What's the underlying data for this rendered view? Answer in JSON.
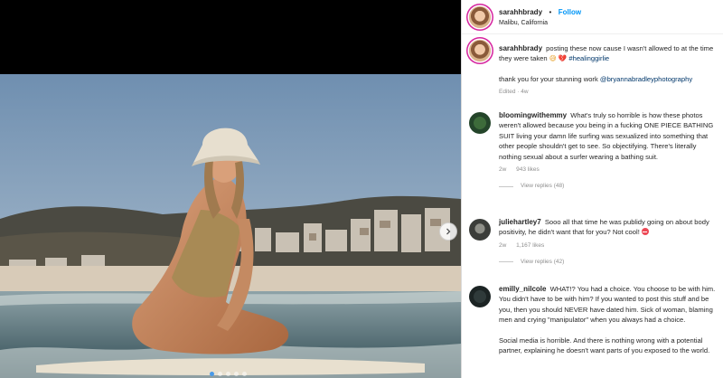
{
  "post": {
    "username": "sarahhbrady",
    "separator": "•",
    "follow_label": "Follow",
    "location": "Malibu, California"
  },
  "colors": {
    "accent": "#0095f6",
    "story_ring": "#d6249f",
    "carousel_active": "#4a9ae8"
  },
  "icons": {
    "next": "chevron-right-icon"
  },
  "carousel": {
    "slide_count": 5,
    "active_index": 0
  },
  "caption": {
    "username": "sarahhbrady",
    "text": "posting these now cause I wasn't allowed to at the time they were taken",
    "emoji_1": "😅",
    "emoji_2": "💔",
    "hashtag": "#healinggirlie",
    "thanks": "thank you for your stunning work",
    "mention": "@bryannabradleyphotography",
    "edited": "Edited · 4w"
  },
  "comments": [
    {
      "username": "bloomingwithemmy",
      "text": "What's truly so horrible is how these photos weren't allowed because you being in a fucking ONE PIECE BATHING SUIT living your damn life surfing was sexualized into something that other people shouldn't get to see. So objectifying. There's literally nothing sexual about a surfer wearing a bathing suit.",
      "time": "2w",
      "likes": "943 likes",
      "replies": "View replies (48)"
    },
    {
      "username": "juliehartley7",
      "text": "Sooo all that time he was publidy going on about body positivity, he didn't want that for you? Not cool!",
      "time": "2w",
      "likes": "1,167 likes",
      "replies": "View replies (42)"
    },
    {
      "username": "emilly_nilcole",
      "text": "WHAT!? You had a choice. You choose to be with him. You didn't have to be with him? If you wanted to post this stuff and be you, then you should NEVER have dated him. Sick of woman, blaming men and crying \"manipulator\" when you always had a choice.",
      "text_2": "Social media is horrible. And there is nothing wrong with a potential partner, explaining he doesn't want parts of you exposed to the world."
    }
  ]
}
